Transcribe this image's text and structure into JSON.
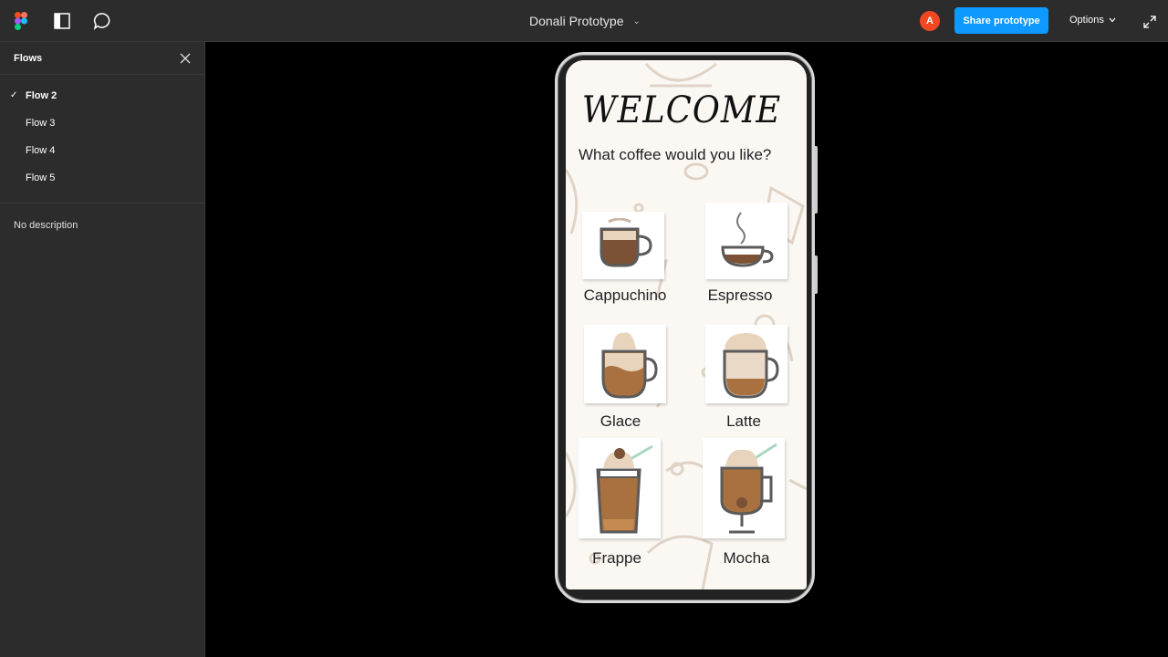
{
  "topbar": {
    "doc_title": "Donali Prototype",
    "avatar_initial": "A",
    "share_label": "Share prototype",
    "options_label": "Options"
  },
  "sidebar": {
    "title": "Flows",
    "flows": [
      {
        "label": "Flow 2",
        "active": true
      },
      {
        "label": "Flow 3",
        "active": false
      },
      {
        "label": "Flow 4",
        "active": false
      },
      {
        "label": "Flow 5",
        "active": false
      }
    ],
    "description": "No description"
  },
  "screen": {
    "heading": "WELCOME",
    "question": "What coffee would you like?",
    "items": [
      {
        "label": "Cappuchino",
        "icon": "cappuccino-cup-icon"
      },
      {
        "label": "Espresso",
        "icon": "espresso-cup-icon"
      },
      {
        "label": "Glace",
        "icon": "glace-cup-icon"
      },
      {
        "label": "Latte",
        "icon": "latte-cup-icon"
      },
      {
        "label": "Frappe",
        "icon": "frappe-glass-icon"
      },
      {
        "label": "Mocha",
        "icon": "mocha-glass-icon"
      }
    ]
  },
  "colors": {
    "topbar_bg": "#2c2c2c",
    "accent": "#0d99ff",
    "avatar": "#f24822",
    "canvas": "#000000",
    "screen_bg": "#fbf8f4",
    "coffee_dark": "#7b5236",
    "coffee_mid": "#a9713f",
    "foam": "#e8d3bd"
  }
}
